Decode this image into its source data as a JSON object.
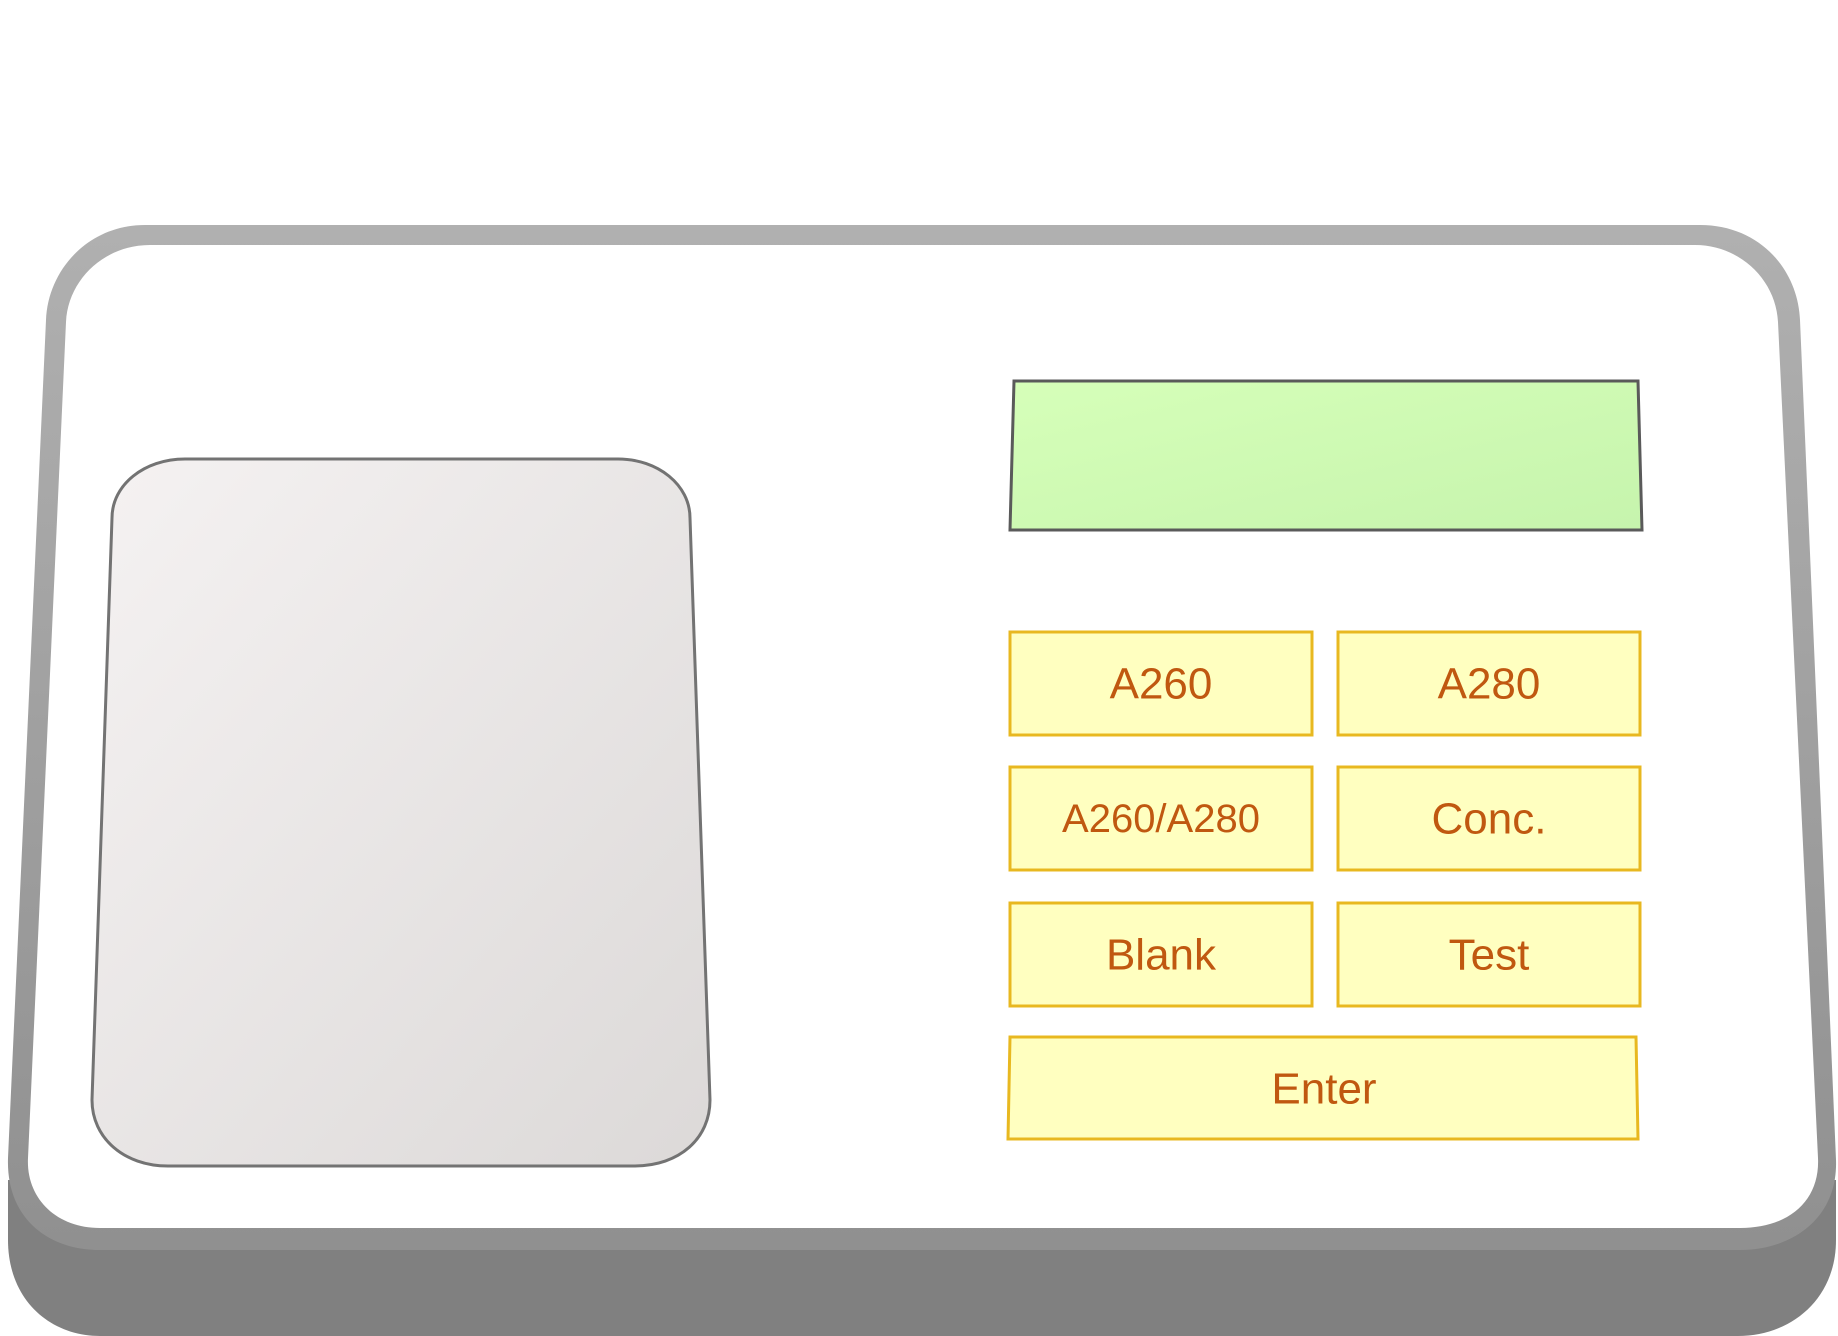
{
  "device": {
    "display": {
      "text": ""
    },
    "keypad": {
      "keys": [
        {
          "id": "a260",
          "label": "A260"
        },
        {
          "id": "a280",
          "label": "A280"
        },
        {
          "id": "ratio",
          "label": "A260/A280"
        },
        {
          "id": "conc",
          "label": "Conc."
        },
        {
          "id": "blank",
          "label": "Blank"
        },
        {
          "id": "test",
          "label": "Test"
        },
        {
          "id": "enter",
          "label": "Enter"
        }
      ]
    }
  },
  "colors": {
    "body_outline": "#a6a6a6",
    "body_face": "#ffffff",
    "body_base": "#808080",
    "display_fill": "#ccf7b4",
    "display_border": "#5a5a5a",
    "key_fill": "#ffffc0",
    "key_border": "#e8b820",
    "key_text": "#c05810",
    "sample_fill": "#e6e3e2",
    "sample_border": "#737373"
  }
}
